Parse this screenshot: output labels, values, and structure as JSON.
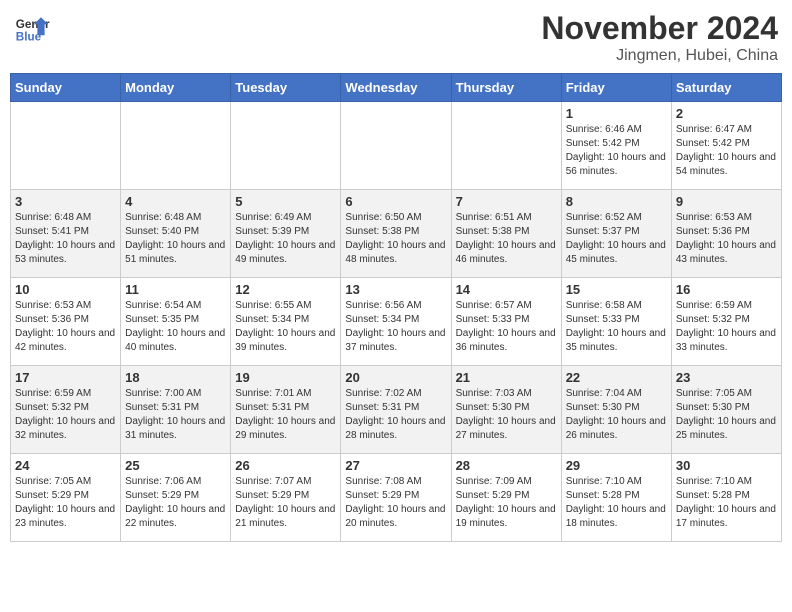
{
  "logo": {
    "line1": "General",
    "line2": "Blue"
  },
  "title": "November 2024",
  "location": "Jingmen, Hubei, China",
  "days_of_week": [
    "Sunday",
    "Monday",
    "Tuesday",
    "Wednesday",
    "Thursday",
    "Friday",
    "Saturday"
  ],
  "weeks": [
    [
      {
        "day": "",
        "info": ""
      },
      {
        "day": "",
        "info": ""
      },
      {
        "day": "",
        "info": ""
      },
      {
        "day": "",
        "info": ""
      },
      {
        "day": "",
        "info": ""
      },
      {
        "day": "1",
        "info": "Sunrise: 6:46 AM\nSunset: 5:42 PM\nDaylight: 10 hours and 56 minutes."
      },
      {
        "day": "2",
        "info": "Sunrise: 6:47 AM\nSunset: 5:42 PM\nDaylight: 10 hours and 54 minutes."
      }
    ],
    [
      {
        "day": "3",
        "info": "Sunrise: 6:48 AM\nSunset: 5:41 PM\nDaylight: 10 hours and 53 minutes."
      },
      {
        "day": "4",
        "info": "Sunrise: 6:48 AM\nSunset: 5:40 PM\nDaylight: 10 hours and 51 minutes."
      },
      {
        "day": "5",
        "info": "Sunrise: 6:49 AM\nSunset: 5:39 PM\nDaylight: 10 hours and 49 minutes."
      },
      {
        "day": "6",
        "info": "Sunrise: 6:50 AM\nSunset: 5:38 PM\nDaylight: 10 hours and 48 minutes."
      },
      {
        "day": "7",
        "info": "Sunrise: 6:51 AM\nSunset: 5:38 PM\nDaylight: 10 hours and 46 minutes."
      },
      {
        "day": "8",
        "info": "Sunrise: 6:52 AM\nSunset: 5:37 PM\nDaylight: 10 hours and 45 minutes."
      },
      {
        "day": "9",
        "info": "Sunrise: 6:53 AM\nSunset: 5:36 PM\nDaylight: 10 hours and 43 minutes."
      }
    ],
    [
      {
        "day": "10",
        "info": "Sunrise: 6:53 AM\nSunset: 5:36 PM\nDaylight: 10 hours and 42 minutes."
      },
      {
        "day": "11",
        "info": "Sunrise: 6:54 AM\nSunset: 5:35 PM\nDaylight: 10 hours and 40 minutes."
      },
      {
        "day": "12",
        "info": "Sunrise: 6:55 AM\nSunset: 5:34 PM\nDaylight: 10 hours and 39 minutes."
      },
      {
        "day": "13",
        "info": "Sunrise: 6:56 AM\nSunset: 5:34 PM\nDaylight: 10 hours and 37 minutes."
      },
      {
        "day": "14",
        "info": "Sunrise: 6:57 AM\nSunset: 5:33 PM\nDaylight: 10 hours and 36 minutes."
      },
      {
        "day": "15",
        "info": "Sunrise: 6:58 AM\nSunset: 5:33 PM\nDaylight: 10 hours and 35 minutes."
      },
      {
        "day": "16",
        "info": "Sunrise: 6:59 AM\nSunset: 5:32 PM\nDaylight: 10 hours and 33 minutes."
      }
    ],
    [
      {
        "day": "17",
        "info": "Sunrise: 6:59 AM\nSunset: 5:32 PM\nDaylight: 10 hours and 32 minutes."
      },
      {
        "day": "18",
        "info": "Sunrise: 7:00 AM\nSunset: 5:31 PM\nDaylight: 10 hours and 31 minutes."
      },
      {
        "day": "19",
        "info": "Sunrise: 7:01 AM\nSunset: 5:31 PM\nDaylight: 10 hours and 29 minutes."
      },
      {
        "day": "20",
        "info": "Sunrise: 7:02 AM\nSunset: 5:31 PM\nDaylight: 10 hours and 28 minutes."
      },
      {
        "day": "21",
        "info": "Sunrise: 7:03 AM\nSunset: 5:30 PM\nDaylight: 10 hours and 27 minutes."
      },
      {
        "day": "22",
        "info": "Sunrise: 7:04 AM\nSunset: 5:30 PM\nDaylight: 10 hours and 26 minutes."
      },
      {
        "day": "23",
        "info": "Sunrise: 7:05 AM\nSunset: 5:30 PM\nDaylight: 10 hours and 25 minutes."
      }
    ],
    [
      {
        "day": "24",
        "info": "Sunrise: 7:05 AM\nSunset: 5:29 PM\nDaylight: 10 hours and 23 minutes."
      },
      {
        "day": "25",
        "info": "Sunrise: 7:06 AM\nSunset: 5:29 PM\nDaylight: 10 hours and 22 minutes."
      },
      {
        "day": "26",
        "info": "Sunrise: 7:07 AM\nSunset: 5:29 PM\nDaylight: 10 hours and 21 minutes."
      },
      {
        "day": "27",
        "info": "Sunrise: 7:08 AM\nSunset: 5:29 PM\nDaylight: 10 hours and 20 minutes."
      },
      {
        "day": "28",
        "info": "Sunrise: 7:09 AM\nSunset: 5:29 PM\nDaylight: 10 hours and 19 minutes."
      },
      {
        "day": "29",
        "info": "Sunrise: 7:10 AM\nSunset: 5:28 PM\nDaylight: 10 hours and 18 minutes."
      },
      {
        "day": "30",
        "info": "Sunrise: 7:10 AM\nSunset: 5:28 PM\nDaylight: 10 hours and 17 minutes."
      }
    ]
  ]
}
